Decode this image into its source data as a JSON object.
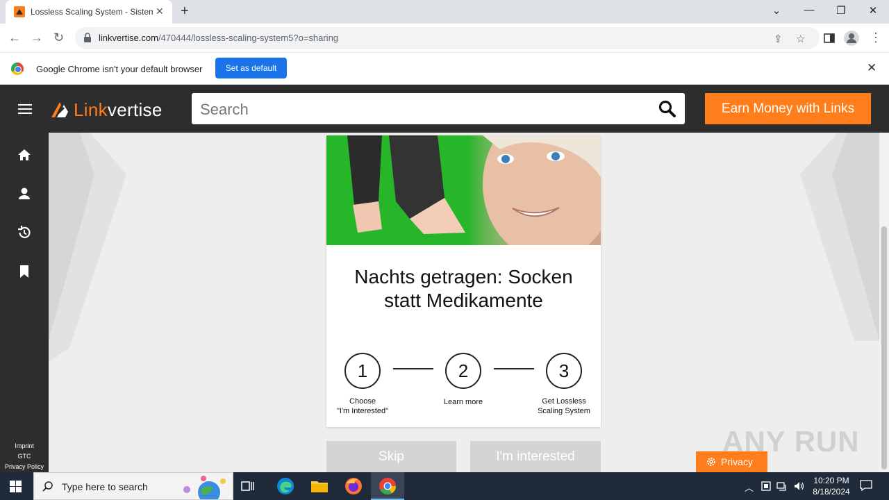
{
  "browser": {
    "tab_title": "Lossless Scaling System - Sistem",
    "new_tab": "+",
    "url_host": "linkvertise.com",
    "url_path": "/470444/lossless-scaling-system5?o=sharing",
    "window_controls": [
      "chevron-down",
      "minimize",
      "restore",
      "close"
    ]
  },
  "infobar": {
    "message": "Google Chrome isn't your default browser",
    "button": "Set as default"
  },
  "site": {
    "logo_link": "Link",
    "logo_vertise": "vertise",
    "search_placeholder": "Search",
    "earn_button": "Earn Money with Links",
    "sidebar_icons": [
      "home-icon",
      "user-icon",
      "history-icon",
      "bookmark-icon"
    ],
    "footer_links": [
      "Imprint",
      "GTC",
      "Privacy Policy"
    ]
  },
  "card": {
    "ad_title_line1": "Nachts getragen: Socken",
    "ad_title_line2": "statt Medikamente",
    "steps": [
      {
        "number": "1",
        "label_line1": "Choose",
        "label_line2": "\"I'm Interested\""
      },
      {
        "number": "2",
        "label_line1": "Learn more",
        "label_line2": ""
      },
      {
        "number": "3",
        "label_line1": "Get Lossless",
        "label_line2": "Scaling System"
      }
    ]
  },
  "actions": {
    "skip": "Skip",
    "interested": "I'm interested"
  },
  "privacy_button": "Privacy",
  "watermark": "ANY RUN",
  "taskbar": {
    "search_placeholder": "Type here to search",
    "time": "10:20 PM",
    "date": "8/18/2024"
  },
  "colors": {
    "accent": "#ff7d1a",
    "header_bg": "#2d2d2d",
    "infobar_button": "#1a73e8",
    "ad_green": "#27b52a"
  }
}
